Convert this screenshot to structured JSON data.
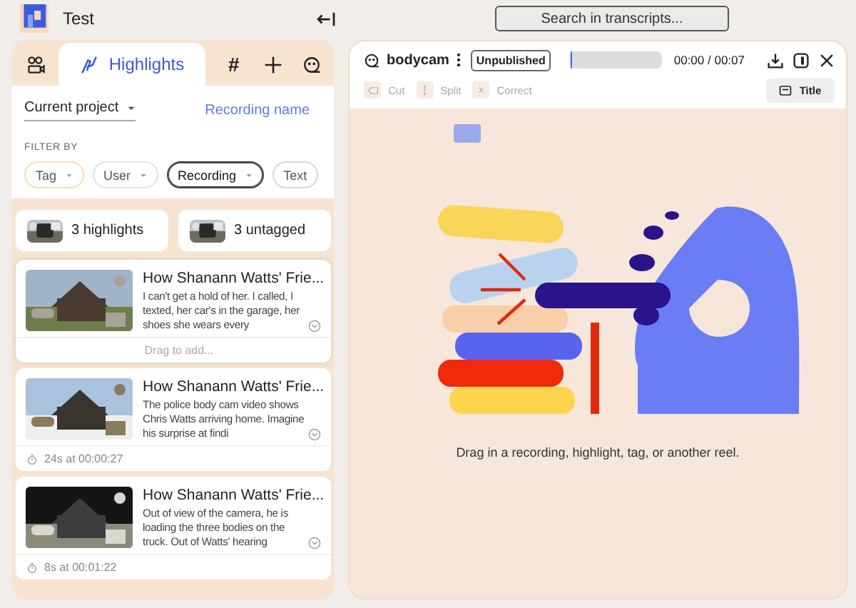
{
  "app": {
    "title": "Test"
  },
  "search": {
    "placeholder": "Search in transcripts..."
  },
  "left_panel": {
    "tabs": [
      {
        "kind": "recordings",
        "selected": false
      },
      {
        "kind": "highlights",
        "label": "Highlights",
        "selected": true
      },
      {
        "kind": "tags",
        "glyph": "#",
        "selected": false
      },
      {
        "kind": "add",
        "selected": false
      },
      {
        "kind": "reels",
        "selected": false
      }
    ],
    "scope_dropdown": "Current project",
    "sort_link": "Recording name",
    "filter_label": "FILTER BY",
    "filters": [
      {
        "label": "Tag",
        "dropdown": true,
        "selected": false,
        "color": "#f6dfb5"
      },
      {
        "label": "User",
        "dropdown": true,
        "selected": false,
        "color": "#d9e6e2"
      },
      {
        "label": "Recording",
        "dropdown": true,
        "selected": true,
        "color": "#444444"
      },
      {
        "label": "Text",
        "dropdown": false,
        "selected": false,
        "color": "#d8d8d8"
      }
    ],
    "summaries": [
      {
        "label": "3 highlights"
      },
      {
        "label": "3 untagged"
      }
    ],
    "highlights": [
      {
        "title": "How Shanann Watts' Frie...",
        "text": "I can't get a hold of her. I called, I texted, her car's in the garage, her shoes she wears every",
        "kind": "drag",
        "footer": "Drag to add..."
      },
      {
        "title": "How Shanann Watts' Frie...",
        "text": "The police body cam video shows Chris Watts arriving home. Imagine his surprise at findi",
        "kind": "duration",
        "footer": "24s at 00:00:27"
      },
      {
        "title": "How Shanann Watts' Frie...",
        "text": "Out of view of the camera, he is loading the three bodies on the truck. Out of Watts' hearing",
        "kind": "duration",
        "footer": "8s at 00:01:22"
      }
    ]
  },
  "reel": {
    "name": "bodycam",
    "status": "Unpublished",
    "progress": {
      "level": 0.03
    },
    "time": "00:00 / 00:07",
    "tools": [
      {
        "kind": "icon",
        "label": "Cut",
        "disabled": true
      },
      {
        "kind": "key",
        "key": "[",
        "label": "Split",
        "disabled": true
      },
      {
        "kind": "key",
        "key": "x",
        "label": "Correct",
        "disabled": true
      }
    ],
    "title_button": "Title",
    "empty_hint": "Drag in a recording, highlight, tag, or another reel."
  }
}
